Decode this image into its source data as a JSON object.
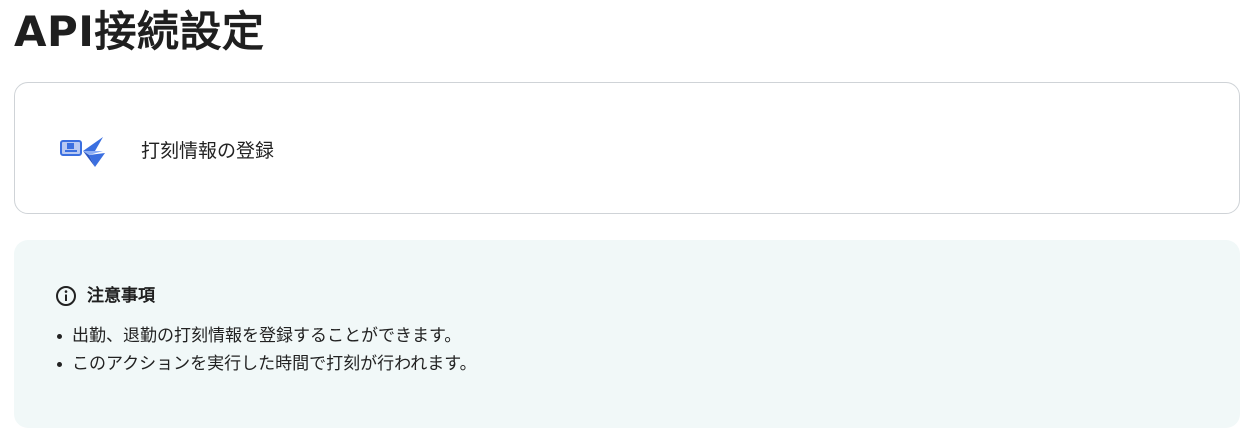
{
  "page": {
    "title": "API接続設定"
  },
  "action": {
    "label": "打刻情報の登録",
    "icon": "attendance-app-icon",
    "accent_color": "#3b6fe0"
  },
  "notice": {
    "icon": "info-icon",
    "title": "注意事項",
    "items": [
      "出勤、退勤の打刻情報を登録することができます。",
      "このアクションを実行した時間で打刻が行われます。"
    ],
    "background_color": "#f1f8f8"
  }
}
